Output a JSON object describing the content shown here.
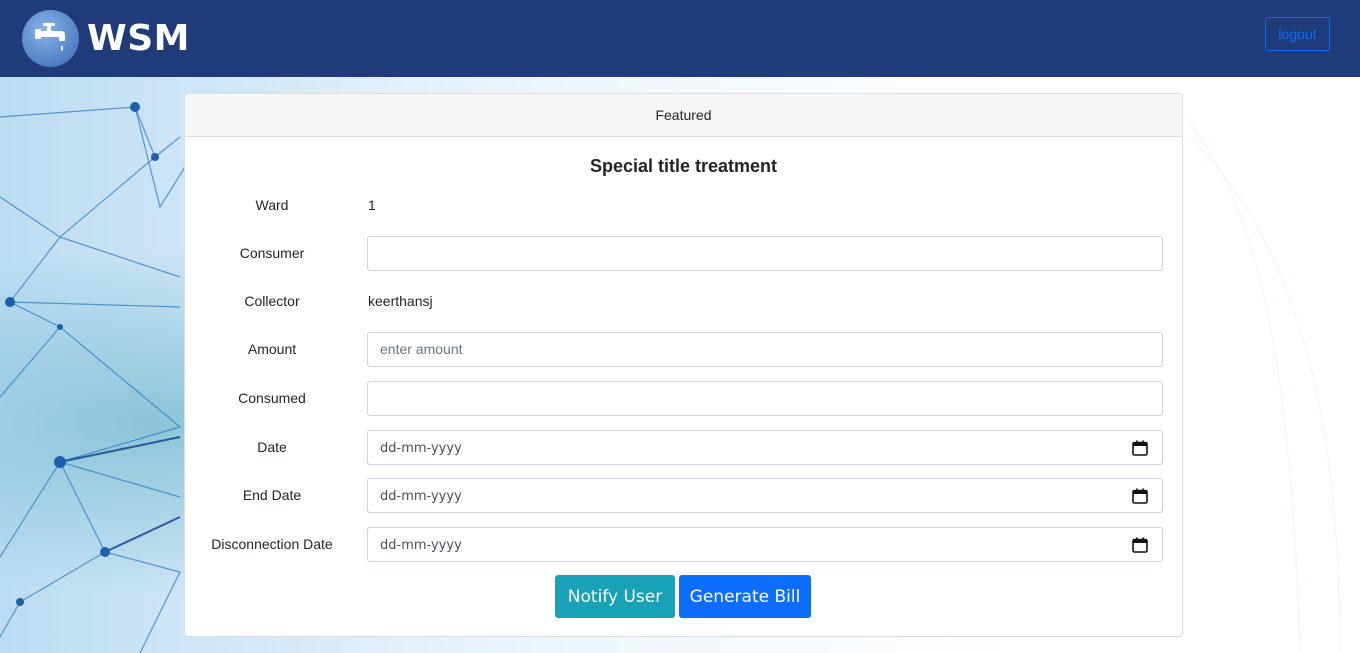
{
  "navbar": {
    "brand": "WSM",
    "logo_icon": "water-tap-icon",
    "logout_label": "logout"
  },
  "card": {
    "header": "Featured",
    "title": "Special title treatment",
    "fields": {
      "ward_label": "Ward",
      "ward_value": "1",
      "consumer_label": "Consumer",
      "consumer_value": "",
      "collector_label": "Collector",
      "collector_value": "keerthansj",
      "amount_label": "Amount",
      "amount_placeholder": "enter amount",
      "consumed_label": "Consumed",
      "consumed_value": "",
      "date_label": "Date",
      "date_value": "dd-mm-yyyy",
      "end_date_label": "End Date",
      "end_date_value": "dd-mm-yyyy",
      "disconnection_label": "Disconnection Date",
      "disconnection_value": "dd-mm-yyyy"
    },
    "buttons": {
      "notify_label": "Notify User",
      "bill_label": "Generate Bill"
    }
  },
  "colors": {
    "navbar": "#1f3b7a",
    "notify": "#17a2b8",
    "bill": "#0d6efd"
  }
}
